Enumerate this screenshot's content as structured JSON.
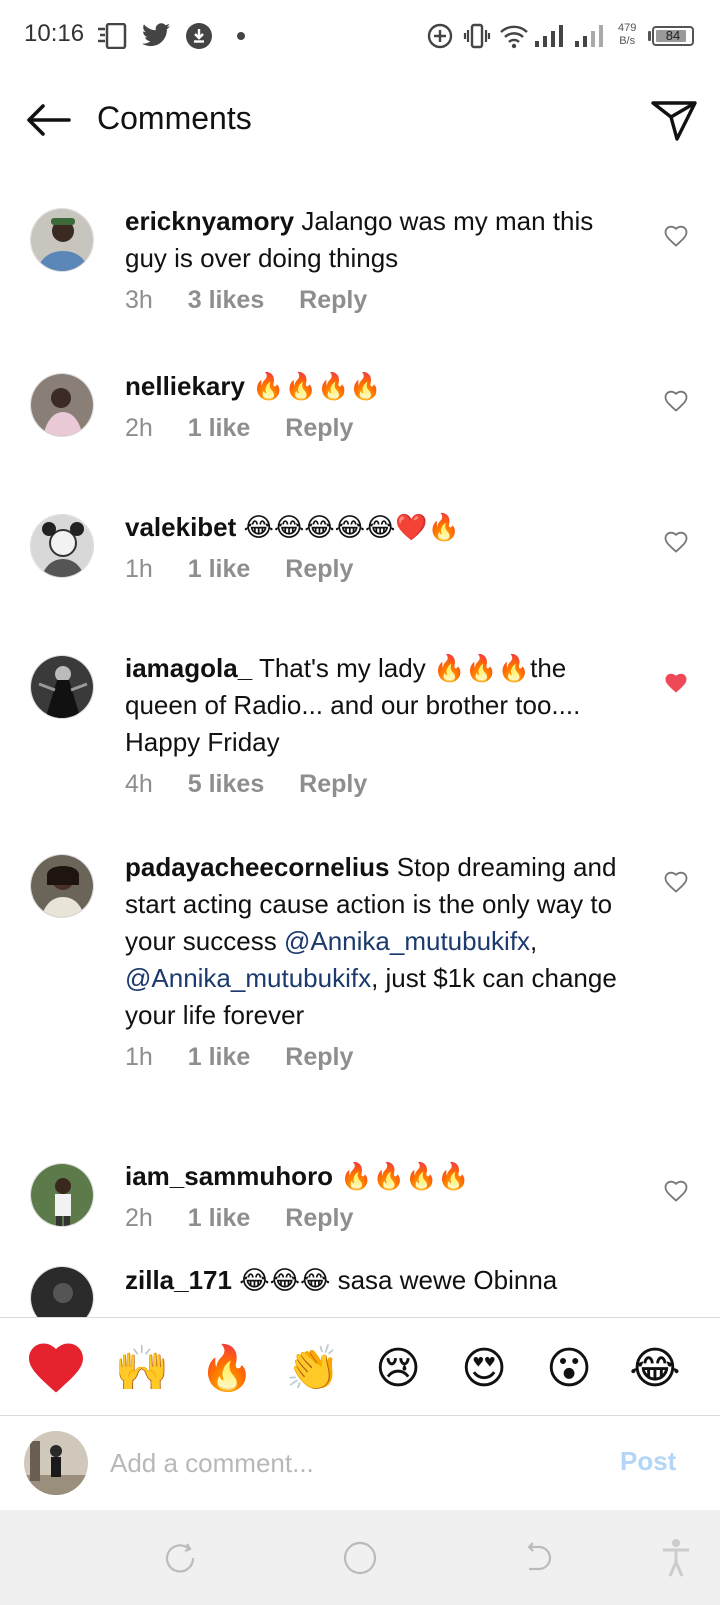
{
  "status_bar": {
    "time": "10:16",
    "net_speed_value": "479",
    "net_speed_unit": "B/s",
    "battery_level": "84"
  },
  "header": {
    "title": "Comments"
  },
  "comments": [
    {
      "username": "ericknyamory",
      "text": "Jalango was my man this guy is over doing things",
      "time": "3h",
      "likes": "3 likes",
      "reply": "Reply",
      "liked": false
    },
    {
      "username": "nelliekary",
      "text": "🔥🔥🔥🔥",
      "time": "2h",
      "likes": "1 like",
      "reply": "Reply",
      "liked": false
    },
    {
      "username": "valekibet",
      "text": "😂😂😂😂😂❤️🔥",
      "time": "1h",
      "likes": "1 like",
      "reply": "Reply",
      "liked": false
    },
    {
      "username": "iamagola_",
      "text_before": "That's my lady",
      "text_after": "the queen of Radio... and our brother too.... Happy Friday",
      "time": "4h",
      "likes": "5 likes",
      "reply": "Reply",
      "liked": true
    },
    {
      "username": "padayacheecornelius",
      "text_part1": "Stop dreaming and start acting cause action is the only way to your success",
      "mention1": "@Annika_mutubukifx",
      "comma": ",",
      "mention2": "@Annika_mutubukifx",
      "text_part2": ", just $1k can change your life forever",
      "time": "1h",
      "likes": "1 like",
      "reply": "Reply",
      "liked": false
    },
    {
      "username": "iam_sammuhoro",
      "text": "🔥🔥🔥🔥",
      "time": "2h",
      "likes": "1 like",
      "reply": "Reply",
      "liked": false
    },
    {
      "username": "zilla_171",
      "text": "😂😂😂 sasa wewe Obinna"
    }
  ],
  "reactions": [
    "❤️",
    "🙌",
    "🔥",
    "👏",
    "😢",
    "😍",
    "😮",
    "😂"
  ],
  "composer": {
    "placeholder": "Add a comment...",
    "post_label": "Post"
  },
  "colors": {
    "liked_heart": "#ed4956",
    "mention": "#1c3a6e",
    "meta_gray": "#8e8e8e",
    "post_disabled": "#b3d6f8"
  }
}
